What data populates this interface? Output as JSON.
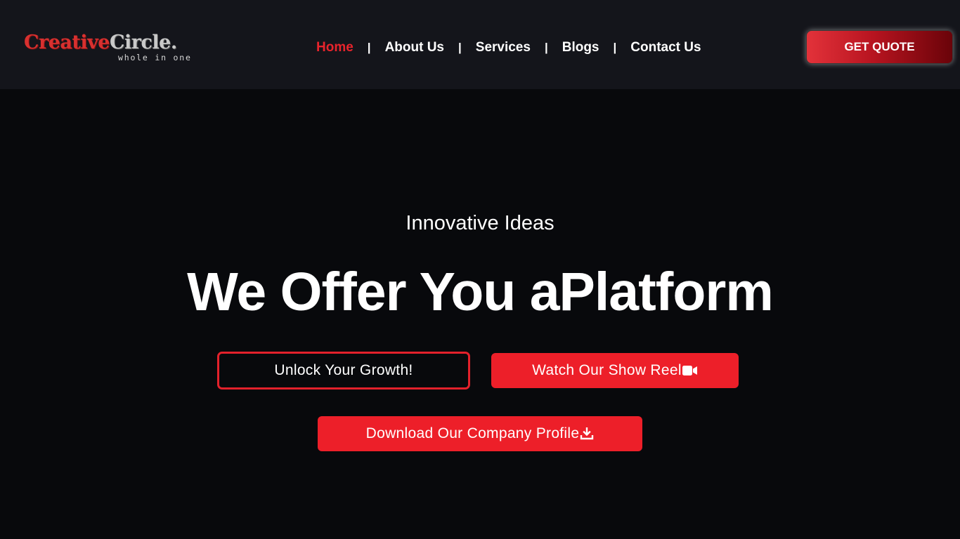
{
  "logo": {
    "part1": "Creative",
    "part2": "Circle.",
    "tagline": "whole in one"
  },
  "nav": {
    "items": [
      "Home",
      "About Us",
      "Services",
      "Blogs",
      "Contact Us"
    ],
    "separator": "|"
  },
  "header_cta": "GET QUOTE",
  "hero": {
    "kicker": "Innovative Ideas",
    "title": "We Offer You aPlatform",
    "buttons": {
      "unlock": "Unlock Your Growth!",
      "showreel": "Watch Our Show Reel",
      "profile": "Download Our Company Profile"
    }
  },
  "icons": {
    "showreel": "video-camera-icon",
    "profile": "download-icon"
  },
  "colors": {
    "accent": "#ed1f29",
    "header_bg": "#14151b",
    "page_bg": "#08090c"
  }
}
